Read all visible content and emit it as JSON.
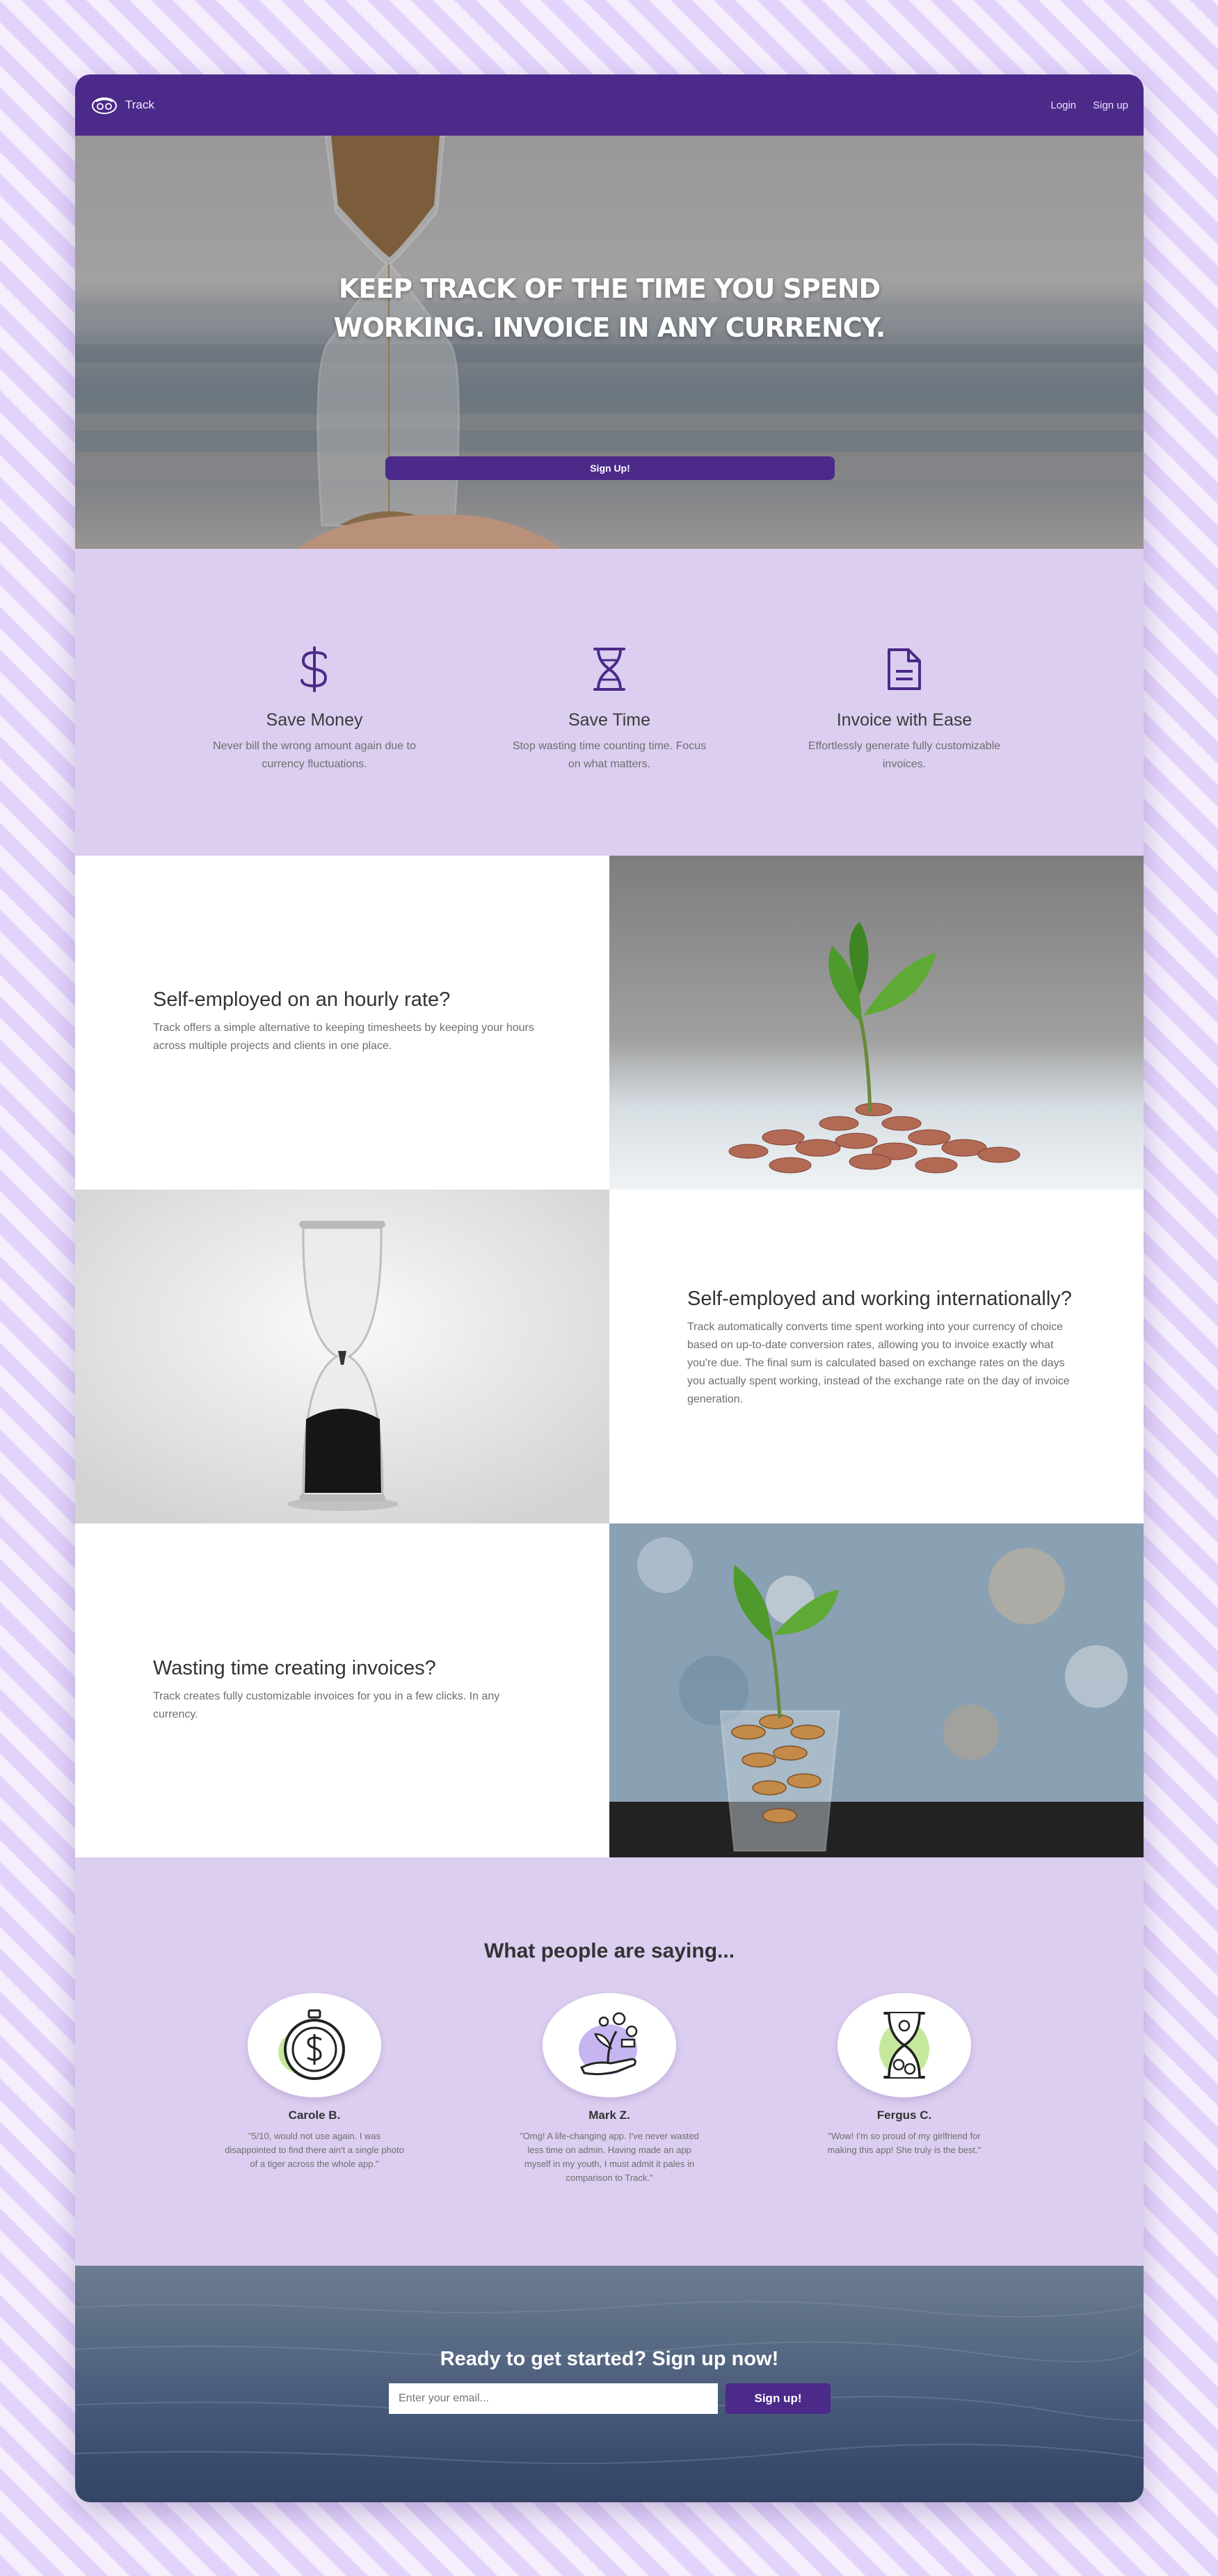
{
  "nav": {
    "brand": "Track",
    "logo_icon": "track-logo-icon",
    "login": "Login",
    "signup": "Sign up"
  },
  "hero": {
    "title": "Keep track of the time you spend working. Invoice in any currency.",
    "button": "Sign Up!"
  },
  "features": [
    {
      "icon": "dollar-sign-icon",
      "title": "Save Money",
      "text": "Never bill the wrong amount again due to currency fluctuations."
    },
    {
      "icon": "hourglass-icon",
      "title": "Save Time",
      "text": "Stop wasting time counting time. Focus on what matters."
    },
    {
      "icon": "file-text-icon",
      "title": "Invoice with Ease",
      "text": "Effortlessly generate fully customizable invoices."
    }
  ],
  "rows": [
    {
      "title": "Self-employed on an hourly rate?",
      "text": "Track offers a simple alternative to keeping timesheets by keeping your hours across multiple projects and clients in one place."
    },
    {
      "title": "Self-employed and working internationally?",
      "text": "Track automatically converts time spent working into your currency of choice based on up-to-date conversion rates, allowing you to invoice exactly what you're due. The final sum is calculated based on exchange rates on the days you actually spent working, instead of the exchange rate on the day of invoice generation."
    },
    {
      "title": "Wasting time creating invoices?",
      "text": "Track creates fully customizable invoices for you in a few clicks. In any currency."
    }
  ],
  "testimonials": {
    "title": "What people are saying...",
    "people": [
      {
        "name": "Carole B.",
        "quote": "\"5/10, would not use again. I was disappointed to find there ain't a single photo of a tiger across the whole app.\"",
        "icon": "stopwatch-dollar-icon"
      },
      {
        "name": "Mark Z.",
        "quote": "\"Omg! A life-changing app. I've never wasted less time on admin. Having made an app myself in my youth, I must admit it pales in comparison to Track.\"",
        "icon": "hand-money-plant-icon"
      },
      {
        "name": "Fergus C.",
        "quote": "\"Wow! I'm so proud of my girlfriend for making this app! She truly is the best.\"",
        "icon": "hourglass-money-icon"
      }
    ]
  },
  "cta": {
    "title": "Ready to get started? Sign up now!",
    "email_placeholder": "Enter your email...",
    "button": "Sign up!"
  },
  "colors": {
    "brand_purple": "#4b2a8a",
    "lavender": "#dccef0",
    "avatar_accent_green": "#c6e89c",
    "avatar_accent_purple": "#c7b5f2"
  }
}
